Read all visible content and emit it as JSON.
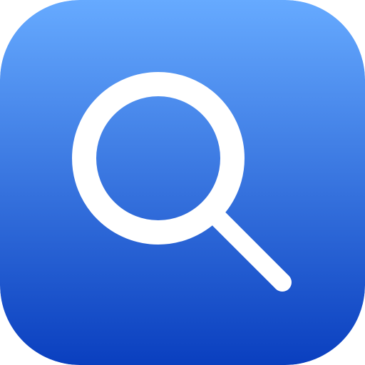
{
  "app_icon": {
    "icon": "search-icon",
    "colors": {
      "gradient_top": "#66aaff",
      "gradient_bottom": "#0a3fbf",
      "glyph": "#ffffff"
    }
  }
}
